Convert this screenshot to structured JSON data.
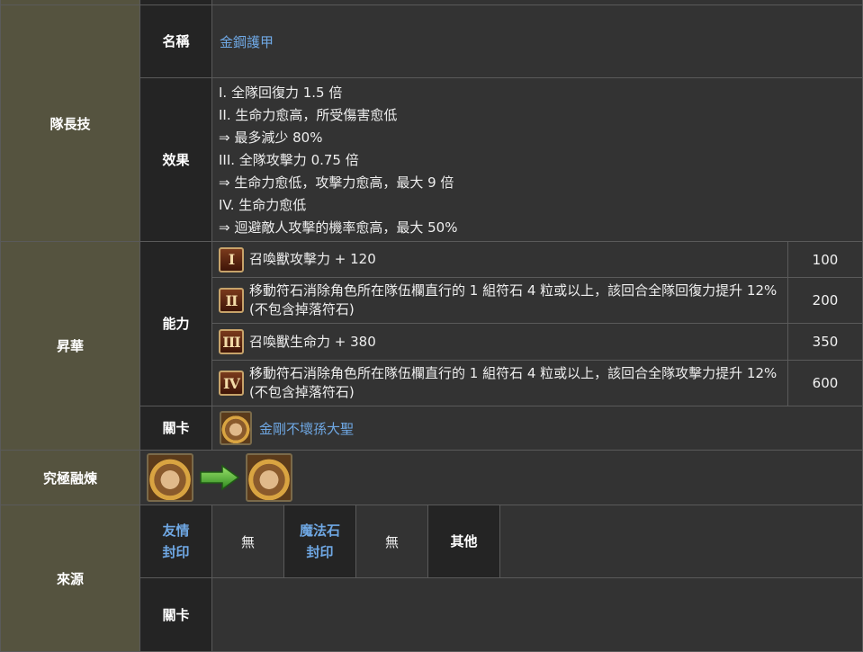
{
  "leader_skill": {
    "section_label": "隊長技",
    "name_label": "名稱",
    "name_value": "金鋼護甲",
    "effect_label": "效果",
    "effect_lines": [
      "I. 全隊回復力 1.5 倍",
      "II. 生命力愈高，所受傷害愈低",
      "⇒ 最多減少 80%",
      "III. 全隊攻擊力 0.75 倍",
      "⇒ 生命力愈低，攻擊力愈高，最大 9 倍",
      "IV. 生命力愈低",
      "⇒ 迴避敵人攻擊的機率愈高，最大 50%"
    ]
  },
  "ascension": {
    "section_label": "昇華",
    "ability_label": "能力",
    "abilities": [
      {
        "numeral": "I",
        "text": "召喚獸攻擊力 + 120",
        "cost": "100"
      },
      {
        "numeral": "II",
        "text": "移動符石消除角色所在隊伍欄直行的 1 組符石 4 粒或以上，該回合全隊回復力提升 12% (不包含掉落符石)",
        "cost": "200"
      },
      {
        "numeral": "III",
        "text": "召喚獸生命力 + 380",
        "cost": "350"
      },
      {
        "numeral": "IV",
        "text": "移動符石消除角色所在隊伍欄直行的 1 組符石 4 粒或以上，該回合全隊攻擊力提升 12% (不包含掉落符石)",
        "cost": "600"
      }
    ],
    "stage_label": "關卡",
    "stage_value": "金剛不壞孫大聖"
  },
  "ultimate_fusion": {
    "section_label": "究極融煉"
  },
  "source": {
    "section_label": "來源",
    "friend_seal_label_1": "友情",
    "friend_seal_label_2": "封印",
    "friend_seal_value": "無",
    "diamond_seal_label_1": "魔法石",
    "diamond_seal_label_2": "封印",
    "diamond_seal_value": "無",
    "other_label": "其他",
    "stage_label": "關卡"
  },
  "colors": {
    "olive_header": "#55533f",
    "dark_header": "#242424",
    "content_bg": "#333333",
    "link": "#6fa8e4",
    "border": "#5a5a5a"
  },
  "icons": [
    "roman-numeral-badge",
    "character-avatar",
    "evolution-arrow-icon"
  ]
}
